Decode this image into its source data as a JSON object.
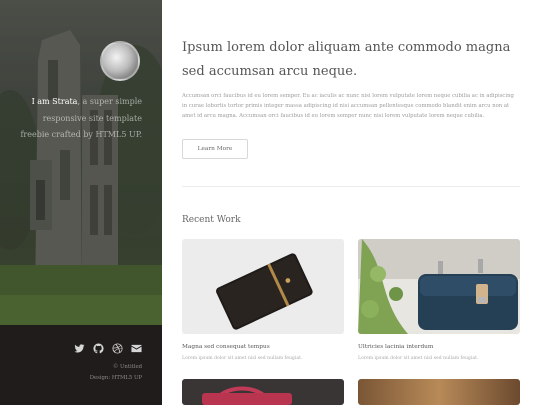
{
  "sidebar": {
    "intro_strong": "I am Strata",
    "intro_rest": ", a super simple responsive site template freebie crafted by HTML5 UP.",
    "social": [
      "twitter-icon",
      "github-icon",
      "dribbble-icon",
      "envelope-icon"
    ],
    "copyright": "© Untitled",
    "credit": "Design: HTML5 UP"
  },
  "main": {
    "headline": "Ipsum lorem dolor aliquam ante commodo magna sed accumsan arcu neque.",
    "description": "Accumsan orci faucibus id eu lorem semper. Eu ac iaculis ac nunc nisi lorem vulputate lorem neque cubilia ac in adipiscing in curae lobortis tortor primis integer massa adipiscing id nisi accumsan pellentesque commodo blandit enim arcu non at amet id arcu magna. Accumsan orci faucibus id eu lorem semper nunc nisi lorem vulputate lorem neque cubilia.",
    "button": "Learn More",
    "section_title": "Recent Work",
    "works": [
      {
        "title": "Magna sed consequat tempus",
        "desc": "Lorem ipsum dolor sit amet nisl sed nullam feugiat."
      },
      {
        "title": "Ultricies lacinia interdum",
        "desc": "Lorem ipsum dolor sit amet nisl sed nullam feugiat."
      }
    ]
  }
}
